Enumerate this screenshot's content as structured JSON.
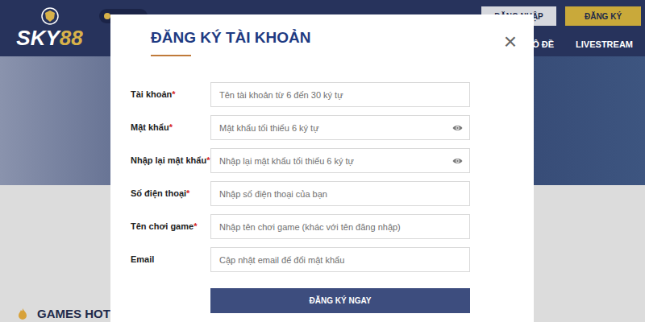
{
  "site": {
    "logo": {
      "main": "SKY",
      "number": "88"
    },
    "auth_buttons": [
      {
        "label": "ĐĂNG NHẬP"
      },
      {
        "label": "ĐĂNG KÝ"
      }
    ],
    "nav": [
      {
        "label": "Ô ĐỀ"
      },
      {
        "label": "LIVESTREAM"
      }
    ],
    "section_title": "GAMES HOT"
  },
  "modal": {
    "title": "ĐĂNG KÝ TÀI KHOẢN",
    "close": "×",
    "required_mark": "*",
    "fields": [
      {
        "label": "Tài khoản",
        "required": true,
        "placeholder": "Tên tài khoản từ 6 đến 30 ký tự",
        "kind": "text"
      },
      {
        "label": "Mật khẩu",
        "required": true,
        "placeholder": "Mật khẩu tối thiểu 6 ký tự",
        "kind": "password"
      },
      {
        "label": "Nhập lại mật khẩu",
        "required": true,
        "placeholder": "Nhập lại mật khẩu tối thiểu 6 ký tự",
        "kind": "password"
      },
      {
        "label": "Số điện thoại",
        "required": true,
        "placeholder": "Nhập số điện thoại của bạn",
        "kind": "text"
      },
      {
        "label": "Tên chơi game",
        "required": true,
        "placeholder": "Nhập tên chơi game (khác với tên đăng nhập)",
        "kind": "text"
      },
      {
        "label": "Email",
        "required": false,
        "placeholder": "Cập nhật email để đổi mật khẩu",
        "kind": "text"
      }
    ],
    "submit": "ĐĂNG KÝ NGAY"
  }
}
